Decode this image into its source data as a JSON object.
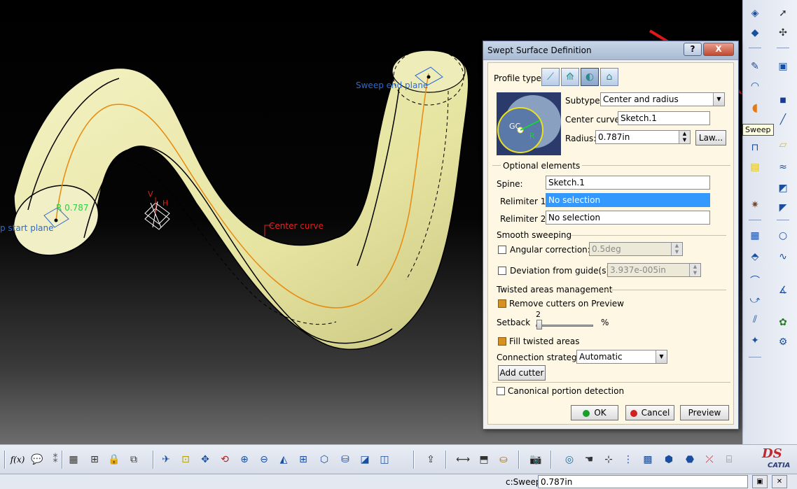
{
  "viewport": {
    "labels": {
      "sweep_end_plane": "Sweep end plane",
      "sweep_start_plane": "p start plane",
      "radius_tag": "0.787",
      "center_curve": "Center curve",
      "center_curve_overlap": "Center",
      "axis_v": "V",
      "axis_h": "H"
    }
  },
  "right_toolbar": {
    "tooltip": "Sweep",
    "highlighted_tool": "sweep-icon"
  },
  "dialog": {
    "title": "Swept Surface Definition",
    "help_label": "?",
    "close_label": "X",
    "profile_type_label": "Profile type:",
    "profile_types": [
      "explicit",
      "line",
      "circle",
      "conic"
    ],
    "active_profile_type": "circle",
    "subtype_label": "Subtype:",
    "subtype_value": "Center and radius",
    "center_curve_label": "Center curve:",
    "center_curve_value": "Sketch.1",
    "radius_label": "Radius:",
    "radius_value": "0.787in",
    "law_button": "Law...",
    "preview_image": {
      "gc_label": "GC",
      "r_label": "R"
    },
    "optional_elements_label": "Optional elements",
    "spine_label": "Spine:",
    "spine_value": "Sketch.1",
    "relimiter1_label": "Relimiter 1:",
    "relimiter1_value": "No selection",
    "relimiter2_label": "Relimiter 2:",
    "relimiter2_value": "No selection",
    "smooth_sweeping_label": "Smooth sweeping",
    "angular_correction_label": "Angular correction:",
    "angular_correction_value": "0.5deg",
    "angular_correction_checked": false,
    "deviation_label": "Deviation from guide(s):",
    "deviation_value": "3.937e-005in",
    "deviation_checked": false,
    "twisted_areas_label": "Twisted areas management",
    "remove_cutters_label": "Remove cutters on Preview",
    "remove_cutters_checked": true,
    "setback_label": "Setback",
    "setback_value": "2",
    "setback_percent": 0.02,
    "percent_label": "%",
    "fill_twisted_label": "Fill twisted areas",
    "fill_twisted_checked": true,
    "connection_strategy_label": "Connection strategy:",
    "connection_strategy_value": "Automatic",
    "add_cutter_button": "Add cutter",
    "canonical_label": "Canonical portion detection",
    "canonical_checked": false,
    "ok_button": "OK",
    "cancel_button": "Cancel",
    "preview_button": "Preview"
  },
  "status_bar": {
    "command_label": "c:Sweep",
    "command_value": "0.787in"
  },
  "bottom_toolbar": {
    "formula_label": "f(x)"
  },
  "logo": {
    "brand": "DS",
    "product": "CATIA"
  },
  "colors": {
    "tube_fill": "#eceaa8",
    "center_curve": "#e88a10",
    "selection_blue": "#3399ff",
    "annotation_blue": "#2a6ad8",
    "annotation_red": "#e02020",
    "annotation_green": "#2ad040"
  }
}
